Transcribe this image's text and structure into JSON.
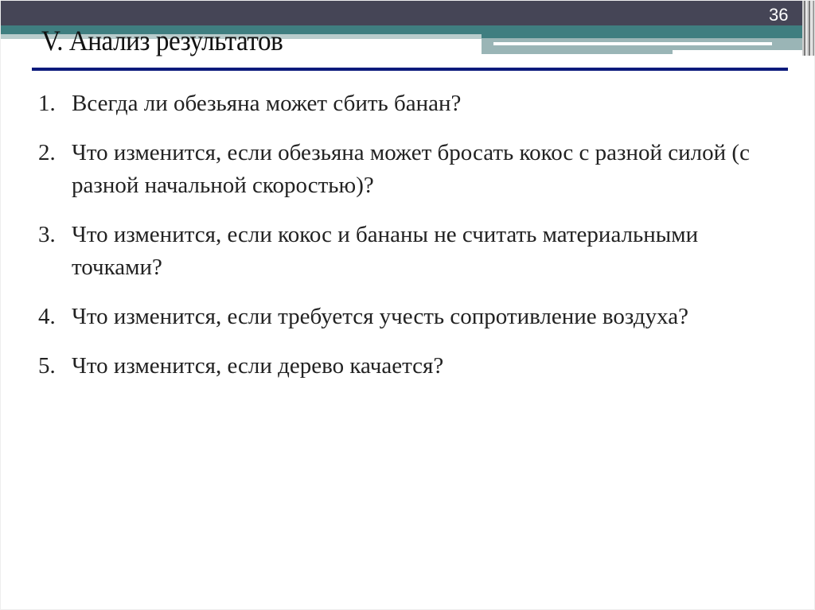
{
  "slide": {
    "number": "36",
    "title": "V. Анализ результатов",
    "items": [
      {
        "n": "1.",
        "text": "Всегда ли обезьяна может сбить банан?"
      },
      {
        "n": "2.",
        "text": "Что изменится, если обезьяна может бросать кокос с разной силой (с разной начальной скоростью)?"
      },
      {
        "n": "3.",
        "text": "Что изменится, если кокос и бананы не считать материальными точками?"
      },
      {
        "n": "4.",
        "text": "Что изменится, если требуется учесть сопротивление воздуха?"
      },
      {
        "n": "5.",
        "text": "Что изменится, если дерево качается?"
      }
    ]
  }
}
